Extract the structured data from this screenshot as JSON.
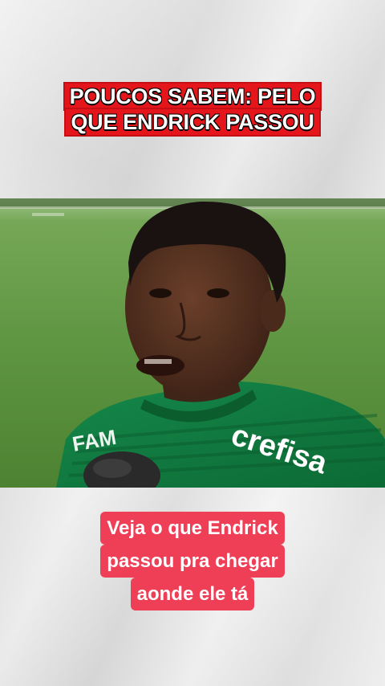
{
  "headline": {
    "line1": "POUCOS SABEM: PELO",
    "line2": "QUE ENDRICK PASSOU"
  },
  "video": {
    "jersey_brand": "crefisa",
    "jersey_sponsor": "FAM",
    "colors": {
      "pitch": "#5c9340",
      "jersey": "#0f7a3c"
    }
  },
  "caption": {
    "line1": "Veja o que Endrick",
    "line2": "passou pra chegar",
    "line3": "aonde ele tá"
  },
  "colors": {
    "headline_bg": "#e4161b",
    "caption_bg": "#ef3f56",
    "background": "#e6e6e6"
  }
}
